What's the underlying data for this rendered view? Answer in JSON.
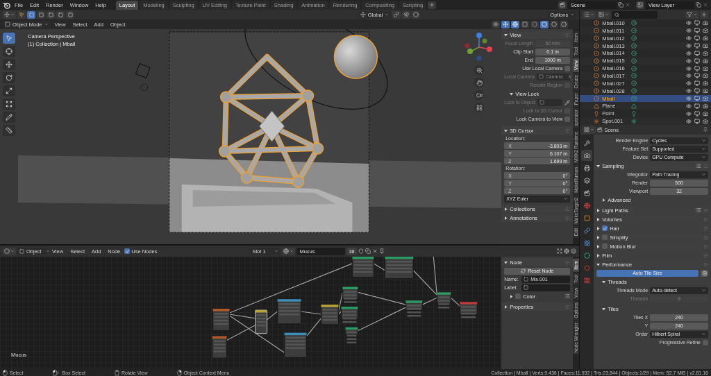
{
  "top_bar": {
    "menus": [
      "File",
      "Edit",
      "Render",
      "Window",
      "Help"
    ],
    "workspaces": [
      {
        "label": "Layout",
        "selected": true
      },
      {
        "label": "Modeling",
        "selected": false
      },
      {
        "label": "Sculpting",
        "selected": false
      },
      {
        "label": "UV Editing",
        "selected": false
      },
      {
        "label": "Texture Paint",
        "selected": false
      },
      {
        "label": "Shading",
        "selected": false
      },
      {
        "label": "Animation",
        "selected": false
      },
      {
        "label": "Rendering",
        "selected": false
      },
      {
        "label": "Compositing",
        "selected": false
      },
      {
        "label": "Scripting",
        "selected": false
      }
    ],
    "scene": "Scene",
    "view_layer": "View Layer"
  },
  "viewport": {
    "orientation": "Global",
    "options": "Options",
    "mode": "Object Mode",
    "menus": [
      "View",
      "Select",
      "Add",
      "Object"
    ],
    "shading": [
      {
        "kind": "wireframe",
        "selected": false
      },
      {
        "kind": "solid",
        "selected": true
      },
      {
        "kind": "material",
        "selected": false
      },
      {
        "kind": "rendered",
        "selected": false
      }
    ],
    "overlay_text": [
      "Camera Perspective",
      "(1) Collection | Mball"
    ],
    "tools": [
      {
        "kind": "select",
        "selected": true
      },
      {
        "kind": "cursor",
        "selected": false
      },
      {
        "kind": "move",
        "selected": false
      },
      {
        "kind": "rotate",
        "selected": false
      },
      {
        "kind": "scale",
        "selected": false
      },
      {
        "kind": "transform",
        "selected": false
      },
      {
        "kind": "annotate",
        "selected": false
      },
      {
        "kind": "measure",
        "selected": false
      }
    ],
    "sidebar": {
      "tabs": [
        {
          "label": "Item",
          "selected": false
        },
        {
          "label": "Tool",
          "selected": false
        },
        {
          "label": "View",
          "selected": true
        },
        {
          "label": "Create",
          "selected": false
        },
        {
          "label": "Paper",
          "selected": false
        },
        {
          "label": "operator",
          "selected": false
        },
        {
          "label": "MHX2 Runtime",
          "selected": false
        },
        {
          "label": "MakeHuman",
          "selected": false
        },
        {
          "label": "MakeTarget2",
          "selected": false
        },
        {
          "label": "Edit",
          "selected": false
        }
      ],
      "panels": [
        {
          "title": "View",
          "expanded": true,
          "rows": [
            {
              "kind": "field",
              "label": "Focal Length",
              "value": "50 mm",
              "disabled": true
            },
            {
              "kind": "field",
              "label": "Clip Start",
              "value": "0.1 m",
              "disabled": false
            },
            {
              "kind": "field",
              "label": "End",
              "value": "1000 m",
              "disabled": false
            },
            {
              "kind": "check",
              "label": "Use Local Camera",
              "checked": false,
              "disabled": false
            },
            {
              "kind": "object",
              "label": "Local Camera",
              "value": "Camera",
              "disabled": true
            },
            {
              "kind": "check",
              "label": "Render Region",
              "checked": false,
              "disabled": true
            }
          ],
          "children": [
            {
              "title": "View Lock",
              "expanded": true,
              "rows": [
                {
                  "kind": "picker",
                  "label": "Lock to Object",
                  "disabled": true
                },
                {
                  "kind": "check",
                  "label": "Lock to 3D Cursor",
                  "checked": false,
                  "disabled": true
                },
                {
                  "kind": "check",
                  "label": "Lock Camera to View",
                  "checked": false,
                  "disabled": false
                }
              ]
            }
          ]
        },
        {
          "title": "3D Cursor",
          "expanded": true,
          "rows": [
            {
              "kind": "caption",
              "label": "Location:"
            },
            {
              "kind": "vector",
              "items": [
                {
                  "axis": "X",
                  "value": "-3.803 m"
                },
                {
                  "axis": "Y",
                  "value": "6.107 m"
                },
                {
                  "axis": "Z",
                  "value": "1.699 m"
                }
              ]
            },
            {
              "kind": "caption",
              "label": "Rotation:"
            },
            {
              "kind": "vector",
              "items": [
                {
                  "axis": "X",
                  "value": "0°"
                },
                {
                  "axis": "Y",
                  "value": "0°"
                },
                {
                  "axis": "Z",
                  "value": "0°"
                }
              ]
            },
            {
              "kind": "dropdown",
              "value": "XYZ Euler"
            }
          ]
        },
        {
          "title": "Collections",
          "expanded": false
        },
        {
          "title": "Annotations",
          "expanded": false
        }
      ]
    }
  },
  "node_editor": {
    "object_type": "Object",
    "menus": [
      "View",
      "Select",
      "Add",
      "Node"
    ],
    "use_nodes": {
      "label": "Use Nodes",
      "checked": true
    },
    "slot": "Slot 1",
    "material": "Mucus",
    "users": "38",
    "canvas_label": "Mucus",
    "sidebar": {
      "tabs": [
        {
          "label": "Item",
          "selected": true
        },
        {
          "label": "Tool",
          "selected": false
        },
        {
          "label": "View",
          "selected": false
        },
        {
          "label": "Options",
          "selected": false
        },
        {
          "label": "Node Wrangler",
          "selected": false
        }
      ],
      "panels": [
        {
          "title": "Node",
          "expanded": true,
          "rows": [
            {
              "kind": "refresh_button",
              "label": "Reset Node",
              "selected": false
            },
            {
              "kind": "name_field",
              "label": "Name:",
              "value": "Mix.001"
            },
            {
              "kind": "name_field",
              "label": "Label:"
            }
          ],
          "children": [
            {
              "title": "Color",
              "expanded": false,
              "checked": false,
              "presets": true
            }
          ]
        },
        {
          "title": "Properties",
          "expanded": false
        }
      ]
    }
  },
  "outliner": {
    "rows": [
      {
        "name": "Mball.010",
        "kind": "metaball",
        "selected": false
      },
      {
        "name": "Mball.011",
        "kind": "metaball",
        "selected": false
      },
      {
        "name": "Mball.012",
        "kind": "metaball",
        "selected": false
      },
      {
        "name": "Mball.013",
        "kind": "metaball",
        "selected": false
      },
      {
        "name": "Mball.014",
        "kind": "metaball",
        "selected": false
      },
      {
        "name": "Mball.015",
        "kind": "metaball",
        "selected": false
      },
      {
        "name": "Mball.016",
        "kind": "metaball",
        "selected": false
      },
      {
        "name": "Mball.017",
        "kind": "metaball",
        "selected": false
      },
      {
        "name": "Mball.027",
        "kind": "metaball",
        "selected": false
      },
      {
        "name": "Mball.028",
        "kind": "metaball",
        "selected": false
      },
      {
        "name": "Mball",
        "kind": "metaball",
        "selected": true
      },
      {
        "name": "Plane",
        "kind": "mesh",
        "selected": false
      },
      {
        "name": "Point",
        "kind": "light",
        "selected": false
      },
      {
        "name": "Spot.001",
        "kind": "spot",
        "selected": false
      }
    ]
  },
  "properties": {
    "context": "Scene",
    "tabs": [
      {
        "kind": "tool",
        "selected": false
      },
      {
        "kind": "render",
        "selected": true
      },
      {
        "kind": "output",
        "selected": false
      },
      {
        "kind": "view_layer",
        "selected": false
      },
      {
        "kind": "scene",
        "selected": false
      },
      {
        "kind": "world",
        "selected": false
      },
      {
        "kind": "object",
        "selected": false
      },
      {
        "kind": "constraints",
        "selected": false
      },
      {
        "kind": "physics",
        "selected": false
      },
      {
        "kind": "data",
        "selected": false
      },
      {
        "kind": "material",
        "selected": false
      },
      {
        "kind": "texture",
        "selected": false
      }
    ],
    "rows": [
      {
        "kind": "dropdown",
        "label": "Render Engine",
        "value": "Cycles"
      },
      {
        "kind": "dropdown",
        "label": "Feature Set",
        "value": "Supported"
      },
      {
        "kind": "dropdown",
        "label": "Device",
        "value": "GPU Compute"
      }
    ],
    "panels": [
      {
        "title": "Sampling",
        "expanded": true,
        "presets": true,
        "rows": [
          {
            "kind": "dropdown",
            "label": "Integrator",
            "value": "Path Tracing"
          },
          {
            "kind": "field",
            "label": "Render",
            "value": "500",
            "disabled": false
          },
          {
            "kind": "field",
            "label": "Viewport",
            "value": "32",
            "disabled": false
          }
        ],
        "children": [
          {
            "title": "Advanced",
            "expanded": false
          }
        ]
      },
      {
        "title": "Light Paths",
        "expanded": false,
        "presets": true
      },
      {
        "title": "Volumes",
        "expanded": false
      },
      {
        "title": "Hair",
        "expanded": false,
        "checked": true
      },
      {
        "title": "Simplify",
        "expanded": false,
        "checked": false
      },
      {
        "title": "Motion Blur",
        "expanded": false,
        "checked": false
      },
      {
        "title": "Film",
        "expanded": false
      },
      {
        "title": "Performance",
        "expanded": true,
        "rows": [
          {
            "kind": "gear_button",
            "label": "Auto Tile Size",
            "selected": true
          }
        ],
        "children": [
          {
            "title": "Threads",
            "expanded": true,
            "rows": [
              {
                "kind": "dropdown",
                "label": "Threads Mode",
                "value": "Auto-detect"
              },
              {
                "kind": "field",
                "label": "Threads",
                "value": "8",
                "disabled": true
              }
            ]
          },
          {
            "title": "Tiles",
            "expanded": true,
            "rows": [
              {
                "kind": "field",
                "label": "Tiles X",
                "value": "240",
                "disabled": false
              },
              {
                "kind": "field",
                "label": "Y",
                "value": "240",
                "disabled": false
              },
              {
                "kind": "dropdown",
                "label": "Order",
                "value": "Hilbert Spiral"
              },
              {
                "kind": "check",
                "label": "Progressive Refine",
                "checked": false,
                "disabled": false
              }
            ]
          }
        ]
      }
    ]
  },
  "status_bar": {
    "actions": [
      {
        "kind": "left",
        "label": "Select"
      },
      {
        "kind": "drag",
        "label": "Box Select"
      },
      {
        "kind": "middle",
        "label": "Rotate View"
      },
      {
        "kind": "right",
        "label": "Object Context Menu"
      }
    ],
    "stats": "Collection | Mball | Verts:9,436 | Faces:11,932 | Tris:23,844 | Objects:1/29 | Mem: 52.7 MiB | v2.81.16"
  }
}
